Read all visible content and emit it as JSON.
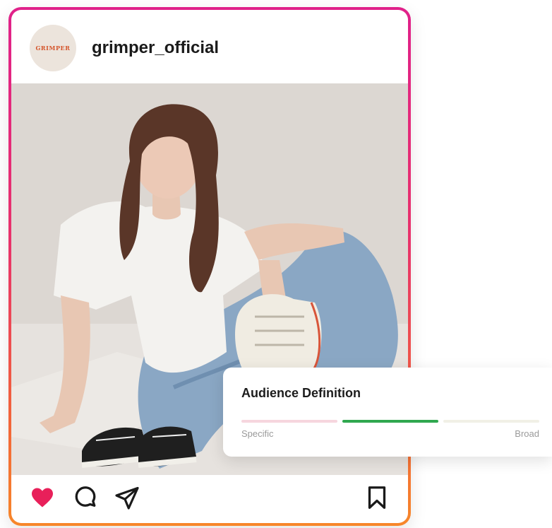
{
  "post": {
    "avatar_text": "GRIMPER",
    "username": "grimper_official",
    "liked": true,
    "accent_color": "#e0218a",
    "like_color": "#e8205a"
  },
  "actions": {
    "icons": [
      "heart-icon",
      "comment-icon",
      "share-icon",
      "bookmark-icon"
    ]
  },
  "audience": {
    "title": "Audience Definition",
    "label_left": "Specific",
    "label_right": "Broad",
    "selected_segment": 2,
    "segment_count": 3,
    "active_color": "#2fa84f"
  }
}
